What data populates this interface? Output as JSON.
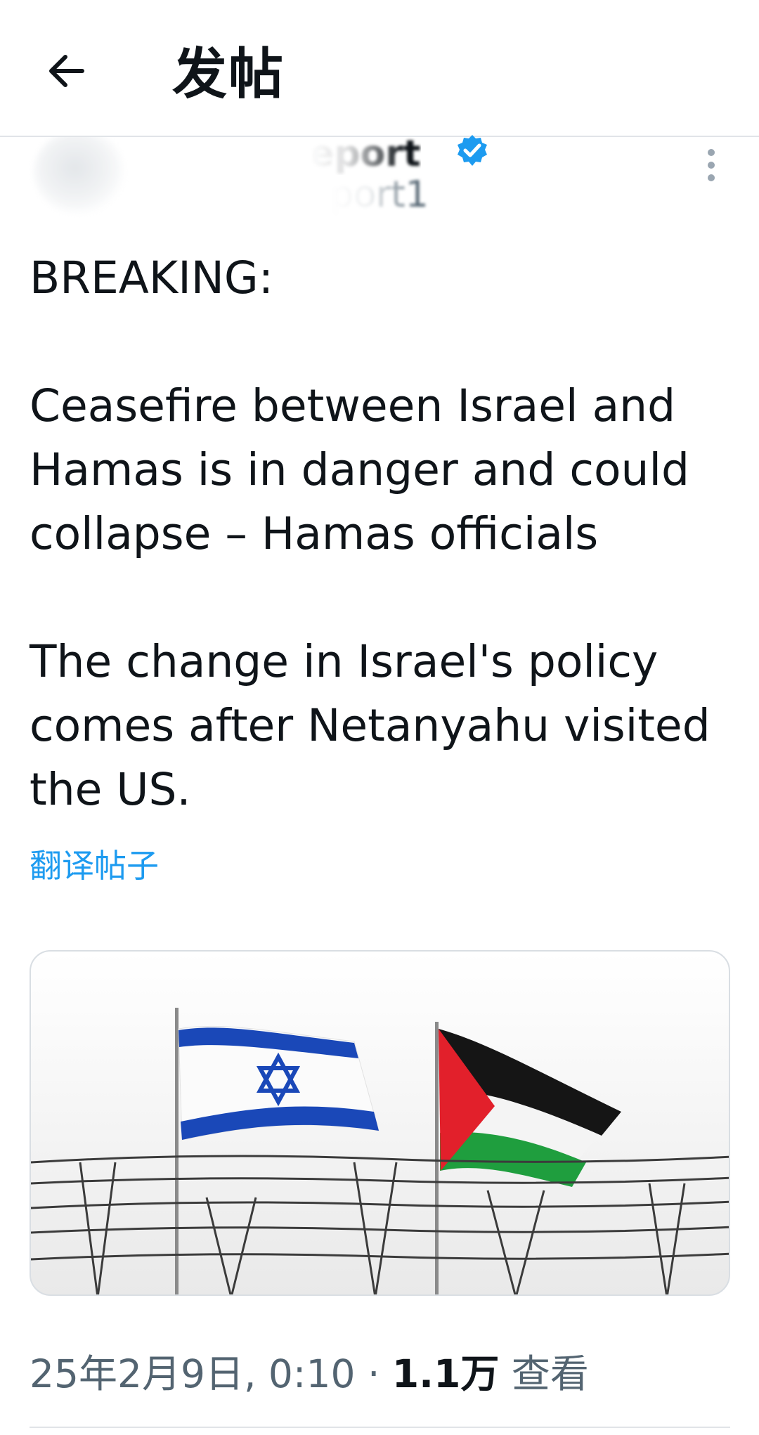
{
  "header": {
    "title": "发帖",
    "back_icon": "arrow-left-icon"
  },
  "author": {
    "name": "eport",
    "handle": "port1",
    "verified_icon": "verified-badge-icon",
    "verified_color": "#1d9bf0",
    "more_icon": "more-vertical-icon"
  },
  "post": {
    "paragraphs": [
      "BREAKING:",
      "Ceasefire between Israel and Hamas is in danger and could collapse – Hamas officials",
      "The change in Israel's policy comes after Netanyahu visited the US."
    ],
    "translate_label": "翻译帖子"
  },
  "media": {
    "description_icon": "flags-image",
    "flags": [
      "israel-flag-icon",
      "palestine-flag-icon"
    ]
  },
  "meta": {
    "timestamp": "25年2月9日, 0:10",
    "separator": "·",
    "views_count": "1.1万",
    "views_label": "查看"
  },
  "colors": {
    "accent": "#1d9bf0",
    "text_primary": "#0f1419",
    "text_secondary": "#536471"
  }
}
